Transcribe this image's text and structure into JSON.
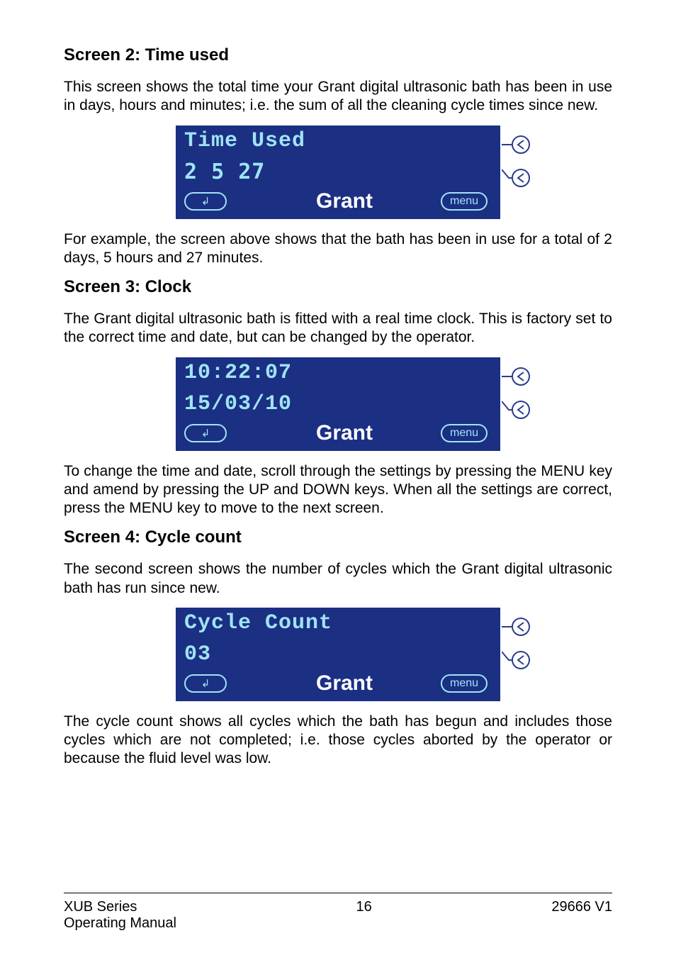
{
  "headings": {
    "s2": "Screen 2: Time used",
    "s3": "Screen 3: Clock",
    "s4": "Screen 4: Cycle count"
  },
  "paragraphs": {
    "p1": "This screen shows the total time your Grant digital ultrasonic bath has been in use in days, hours and minutes; i.e. the sum of all the cleaning cycle times since new.",
    "p2": "For example, the screen above shows that the bath has been in use for a total of 2 days, 5 hours and 27 minutes.",
    "p3": "The Grant digital ultrasonic bath is fitted with a real time clock. This is factory set to the correct time and date, but can be changed by the operator.",
    "p4": "To change the time and date, scroll through the settings by pressing the MENU key and amend by pressing the UP and DOWN keys. When all the settings are correct, press the MENU key to move to the next screen.",
    "p5": "The second screen shows the number of cycles which the Grant digital ultrasonic bath has run since new.",
    "p6": "The cycle count shows all cycles which the bath has begun and includes those cycles which are not completed; i.e. those cycles aborted by the operator or because the fluid level was low."
  },
  "screens": {
    "time_used": {
      "line1": "Time Used",
      "line2": "2 5 27"
    },
    "clock": {
      "line1": "10:22:07",
      "line2": "15/03/10"
    },
    "cycle": {
      "line1": "Cycle Count",
      "line2": "03"
    }
  },
  "buttons": {
    "enter_symbol": "↲",
    "menu_label": "menu"
  },
  "brand": "Grant",
  "footer": {
    "left1": "XUB Series",
    "left2": "Operating Manual",
    "page": "16",
    "right": "29666  V1"
  }
}
